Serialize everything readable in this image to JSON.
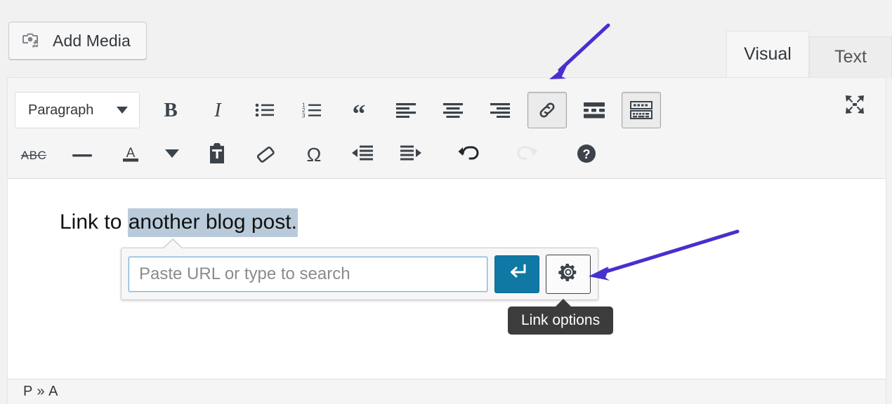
{
  "toolbar_top": {
    "add_media_label": "Add Media",
    "add_media_icon": "camera-music-icon",
    "tabs": [
      {
        "label": "Visual",
        "active": true
      },
      {
        "label": "Text",
        "active": false
      }
    ]
  },
  "format_toolbar": {
    "block_format": {
      "value": "Paragraph",
      "icon": "chevron-down-icon"
    },
    "row1": [
      {
        "name": "bold",
        "label": "B",
        "icon": "bold-icon",
        "active": false
      },
      {
        "name": "italic",
        "label": "I",
        "icon": "italic-icon",
        "active": false
      },
      {
        "name": "bulleted-list",
        "icon": "bulleted-list-icon",
        "active": false
      },
      {
        "name": "numbered-list",
        "icon": "numbered-list-icon",
        "active": false
      },
      {
        "name": "blockquote",
        "icon": "blockquote-icon",
        "active": false
      },
      {
        "name": "align-left",
        "icon": "align-left-icon",
        "active": false
      },
      {
        "name": "align-center",
        "icon": "align-center-icon",
        "active": false
      },
      {
        "name": "align-right",
        "icon": "align-right-icon",
        "active": false
      },
      {
        "name": "insert-link",
        "icon": "link-icon",
        "active": true
      },
      {
        "name": "read-more",
        "icon": "read-more-icon",
        "active": false
      },
      {
        "name": "toolbar-toggle",
        "icon": "keyboard-toolbar-icon",
        "active": true
      }
    ],
    "row2": [
      {
        "name": "strikethrough",
        "label": "ABC",
        "icon": "strikethrough-icon",
        "disabled": false
      },
      {
        "name": "horizontal-line",
        "icon": "horizontal-rule-icon",
        "disabled": false
      },
      {
        "name": "text-color",
        "label": "A",
        "icon": "text-color-icon",
        "disabled": false
      },
      {
        "name": "text-color-dropdown",
        "icon": "chevron-down-icon",
        "disabled": false
      },
      {
        "name": "paste-as-text",
        "icon": "paste-as-text-icon",
        "disabled": false
      },
      {
        "name": "clear-formatting",
        "icon": "eraser-icon",
        "disabled": false
      },
      {
        "name": "special-character",
        "label": "Ω",
        "icon": "omega-icon",
        "disabled": false
      },
      {
        "name": "decrease-indent",
        "icon": "outdent-icon",
        "disabled": false
      },
      {
        "name": "increase-indent",
        "icon": "indent-icon",
        "disabled": false
      },
      {
        "name": "undo",
        "icon": "undo-icon",
        "disabled": false
      },
      {
        "name": "redo",
        "icon": "redo-icon",
        "disabled": true
      },
      {
        "name": "keyboard-shortcuts",
        "icon": "help-question-icon",
        "disabled": false
      }
    ],
    "fullscreen_icon": "distraction-free-fullscreen-icon"
  },
  "content": {
    "paragraph_prefix": "Link to ",
    "paragraph_selected": "another blog post."
  },
  "link_popup": {
    "url_placeholder": "Paste URL or type to search",
    "url_value": "",
    "submit_icon": "return-arrow-icon",
    "options_icon": "gear-icon"
  },
  "tooltip": {
    "label": "Link options"
  },
  "status_bar": {
    "path": "P » A"
  },
  "annotations": {
    "arrow_color": "#4630cf",
    "arrows": [
      {
        "name": "arrow-to-link-button",
        "points_to": "insert-link"
      },
      {
        "name": "arrow-to-gear-button",
        "points_to": "link-options-gear"
      }
    ]
  },
  "colors": {
    "page_bg": "#f1f1f1",
    "toolbar_bg": "#f5f5f5",
    "submit_blue": "#1078a4",
    "selection_blue": "#b9cbdb",
    "tooltip_bg": "#3c3c3c",
    "icon_gray": "#3c434a"
  }
}
